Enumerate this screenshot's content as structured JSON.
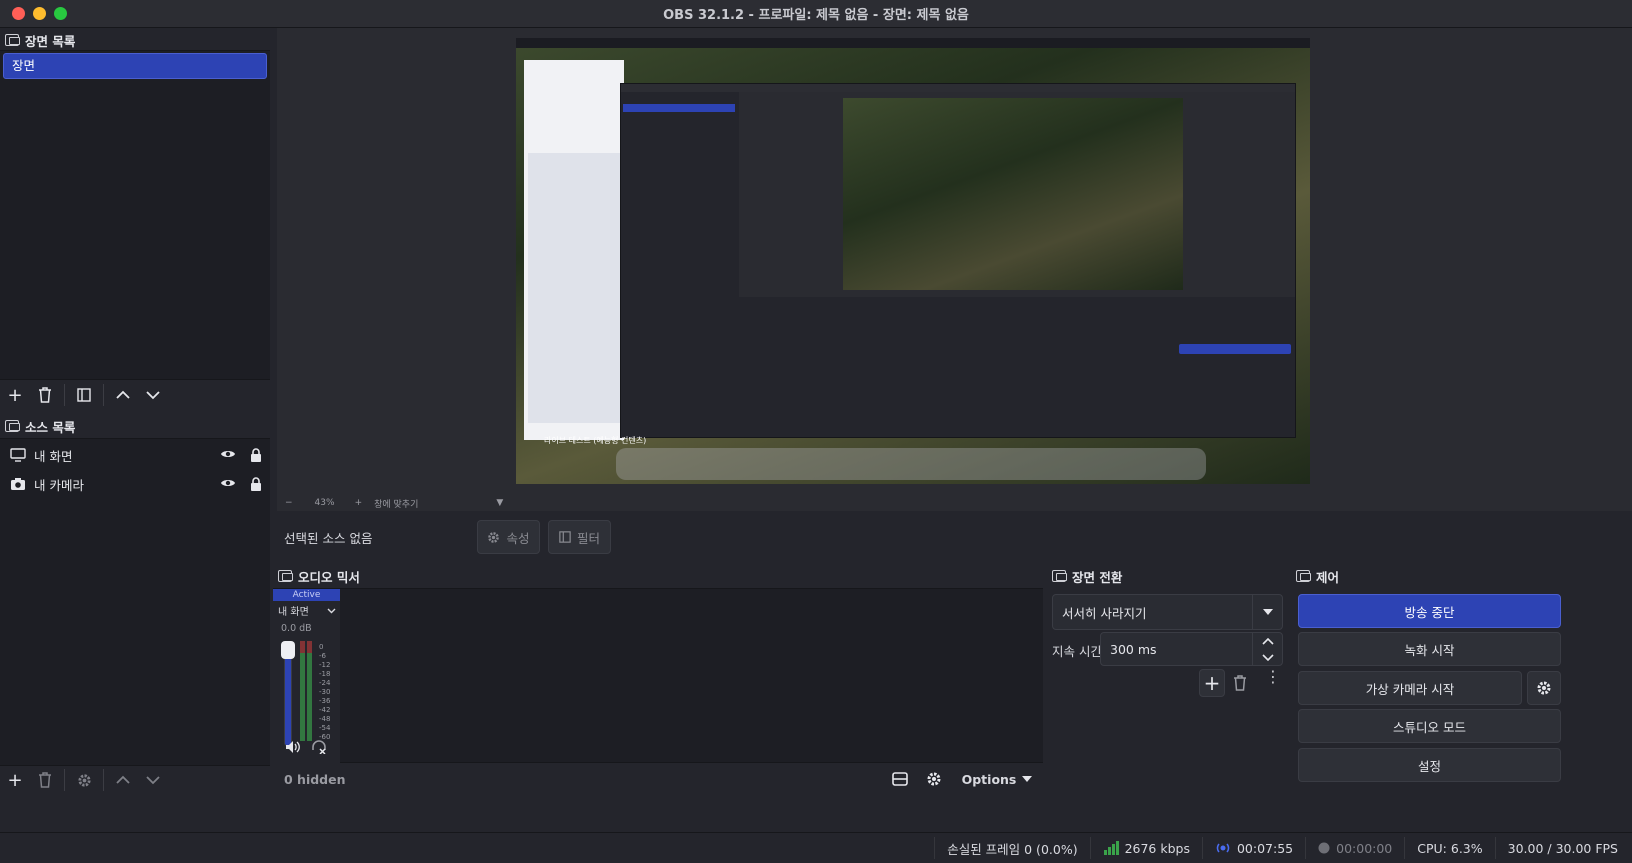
{
  "window": {
    "title": "OBS 32.1.2 - 프로파일: 제목 없음 - 장면: 제목 없음",
    "traffic_colors": [
      "#ff5f57",
      "#febc2e",
      "#28c840"
    ]
  },
  "scenes": {
    "header": "장면 목록",
    "items": [
      {
        "label": "장면",
        "selected": true
      }
    ]
  },
  "sources": {
    "header": "소스 목록",
    "items": [
      {
        "label": "내 화면",
        "icon": "monitor-icon",
        "visible": true,
        "locked": true
      },
      {
        "label": "내 카메라",
        "icon": "camera-icon",
        "visible": true,
        "locked": true
      }
    ]
  },
  "preview": {
    "zoom": "43%",
    "fit_label": "창에 맞추기",
    "caption": "라이브 테스트 (예능형 컨텐츠)"
  },
  "selection": {
    "label": "선택된 소스 없음",
    "properties": "속성",
    "filters": "필터"
  },
  "mixer": {
    "header": "오디오 믹서",
    "channel": {
      "status": "Active",
      "name": "내 화면",
      "level": "0.0 dB",
      "scale": [
        "0",
        "-6",
        "-12",
        "-18",
        "-24",
        "-30",
        "-36",
        "-42",
        "-48",
        "-54",
        "-60"
      ]
    },
    "hidden": "0 hidden",
    "options": "Options"
  },
  "transition": {
    "header": "장면 전환",
    "selected": "서서히 사라지기",
    "duration_label": "지속 시간",
    "duration": "300 ms"
  },
  "controls": {
    "header": "제어",
    "stop_stream": "방송 중단",
    "start_record": "녹화 시작",
    "virtual_cam": "가상 카메라 시작",
    "studio_mode": "스튜디오 모드",
    "settings": "설정"
  },
  "status": {
    "dropped": "손실된 프레임 0 (0.0%)",
    "bitrate": "2676 kbps",
    "stream_time": "00:07:55",
    "record_time": "00:00:00",
    "cpu": "CPU: 6.3%",
    "fps": "30.00 / 30.00 FPS"
  },
  "colors": {
    "accent": "#2d43b4",
    "meter_green": "#3aa34a",
    "meter_red": "#b43a3a"
  }
}
